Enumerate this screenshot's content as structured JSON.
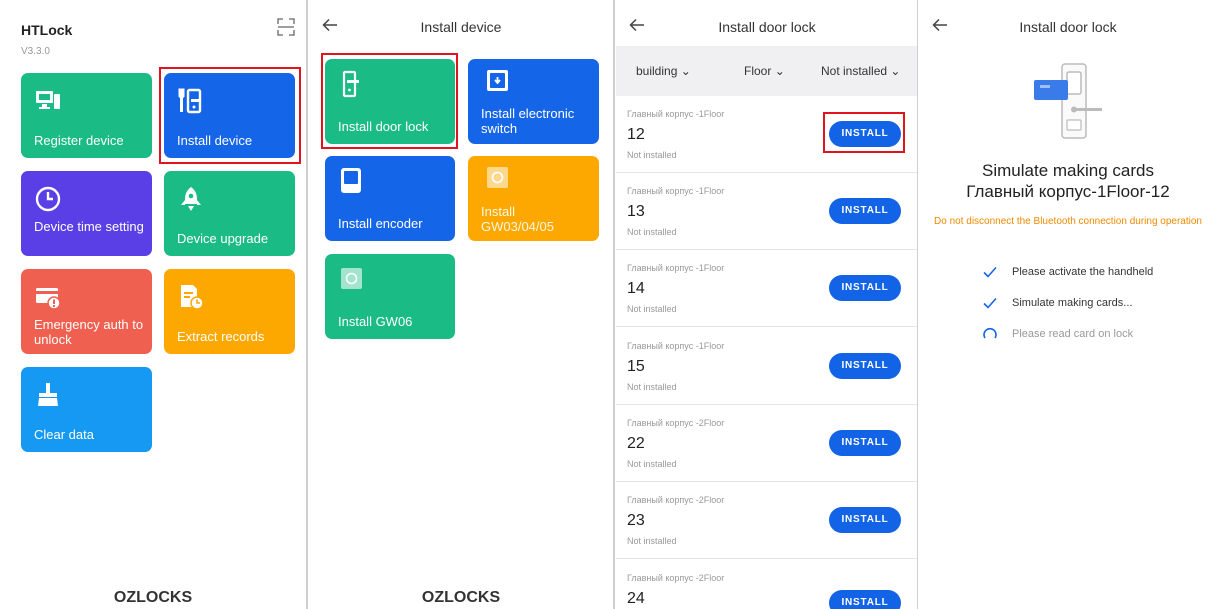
{
  "home": {
    "app_title": "HTLock",
    "version": "V3.3.0",
    "tiles": [
      {
        "label": "Register device",
        "icon": "computer-icon"
      },
      {
        "label": "Install device",
        "icon": "lock-wrench-icon"
      },
      {
        "label": "Device time setting",
        "icon": "clock-icon"
      },
      {
        "label": "Device upgrade",
        "icon": "rocket-icon"
      },
      {
        "label": "Emergency auth to unlock",
        "icon": "card-alert-icon"
      },
      {
        "label": "Extract records",
        "icon": "document-clock-icon"
      },
      {
        "label": "Clear data",
        "icon": "broom-icon"
      }
    ],
    "brand": "OZLOCKS"
  },
  "install_device": {
    "title": "Install device",
    "tiles": [
      {
        "label": "Install door lock",
        "icon": "door-lock-icon"
      },
      {
        "label": "Install electronic switch",
        "icon": "switch-icon"
      },
      {
        "label": "Install encoder",
        "icon": "encoder-icon"
      },
      {
        "label": "Install GW03/04/05",
        "icon": "gateway-icon"
      },
      {
        "label": "Install GW06",
        "icon": "gateway-icon"
      }
    ],
    "brand": "OZLOCKS"
  },
  "install_door_lock": {
    "title": "Install door lock",
    "filters": [
      "building",
      "Floor",
      "Not installed"
    ],
    "button_label": "INSTALL",
    "rows": [
      {
        "building": "Главный корпус -1Floor",
        "number": "12",
        "status": "Not installed"
      },
      {
        "building": "Главный корпус -1Floor",
        "number": "13",
        "status": "Not installed"
      },
      {
        "building": "Главный корпус -1Floor",
        "number": "14",
        "status": "Not installed"
      },
      {
        "building": "Главный корпус -1Floor",
        "number": "15",
        "status": "Not installed"
      },
      {
        "building": "Главный корпус -2Floor",
        "number": "22",
        "status": "Not installed"
      },
      {
        "building": "Главный корпус -2Floor",
        "number": "23",
        "status": "Not installed"
      },
      {
        "building": "Главный корпус -2Floor",
        "number": "24",
        "status": ""
      }
    ]
  },
  "simulate": {
    "title": "Install door lock",
    "heading": "Simulate making cards",
    "room": "Главный корпус-1Floor-12",
    "warning": "Do not disconnect the Bluetooth connection during operation",
    "steps": [
      {
        "text": "Please activate the handheld",
        "state": "done"
      },
      {
        "text": "Simulate making cards...",
        "state": "done"
      },
      {
        "text": "Please read card on lock",
        "state": "pending"
      }
    ]
  },
  "colors": {
    "green": "#1bbb85",
    "blue": "#1565e8",
    "purple": "#5a3ee6",
    "red": "#f06050",
    "orange": "#fda800",
    "sky": "#1699f2",
    "highlight": "#e0141e",
    "warning": "#f08a00"
  }
}
